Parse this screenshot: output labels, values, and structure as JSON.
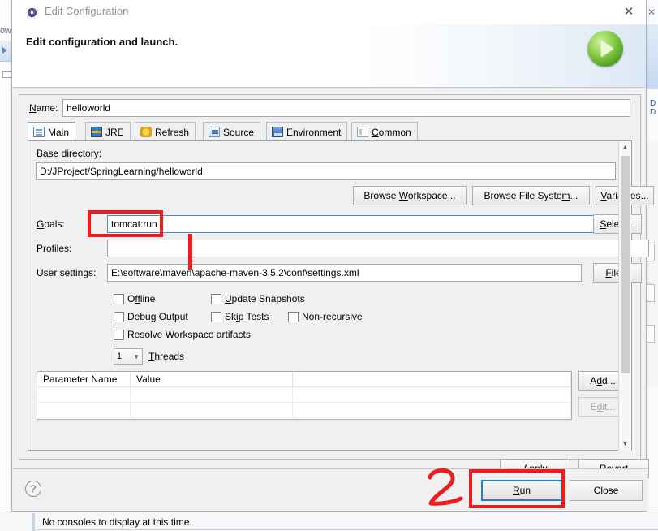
{
  "window": {
    "title": "Edit Configuration",
    "title_icon": "gear-icon",
    "close_icon": "✕",
    "header_title": "Edit configuration and launch.",
    "header_icon": "run-play-icon"
  },
  "name_row": {
    "label": "Name:",
    "value": "helloworld"
  },
  "tabs": [
    {
      "label": "Main",
      "icon": "main-tab-icon",
      "active": true
    },
    {
      "label": "JRE",
      "icon": "jre-tab-icon",
      "active": false
    },
    {
      "label": "Refresh",
      "icon": "refresh-tab-icon",
      "active": false
    },
    {
      "label": "Source",
      "icon": "source-tab-icon",
      "active": false
    },
    {
      "label": "Environment",
      "icon": "environment-tab-icon",
      "active": false
    },
    {
      "label": "Common",
      "icon": "common-tab-icon",
      "active": false
    }
  ],
  "main_tab": {
    "base_directory": {
      "label": "Base directory:",
      "value": "D:/JProject/SpringLearning/helloworld"
    },
    "browse_buttons": {
      "workspace": "Browse Workspace...",
      "file_system": "Browse File System...",
      "variables": "Variables..."
    },
    "goals": {
      "label": "Goals:",
      "value": "tomcat:run",
      "button": "Select..."
    },
    "profiles": {
      "label": "Profiles:",
      "value": ""
    },
    "user_settings": {
      "label": "User settings:",
      "value": "E:\\software\\maven\\apache-maven-3.5.2\\conf\\settings.xml",
      "button": "File..."
    },
    "checkboxes": [
      {
        "label": "Offline",
        "checked": false
      },
      {
        "label": "Update Snapshots",
        "checked": false
      },
      {
        "label": "Debug Output",
        "checked": false
      },
      {
        "label": "Skip Tests",
        "checked": false
      },
      {
        "label": "Non-recursive",
        "checked": false
      },
      {
        "label": "Resolve Workspace artifacts",
        "checked": false
      }
    ],
    "threads": {
      "value": "1",
      "label": "Threads"
    },
    "parameter_table": {
      "columns": [
        "Parameter Name",
        "Value",
        ""
      ],
      "rows": [],
      "add_button": "Add...",
      "edit_button": "Edit..."
    }
  },
  "apply_bar": {
    "apply": "Apply",
    "revert": "Revert"
  },
  "footer": {
    "help_icon": "?",
    "run": "Run",
    "close": "Close"
  },
  "console": {
    "message": "No consoles to display at this time."
  },
  "annotations": {
    "step_number": "2",
    "color": "#ee1c1c"
  },
  "background": {
    "left_text": "ow",
    "right_letters": "D\nD"
  }
}
